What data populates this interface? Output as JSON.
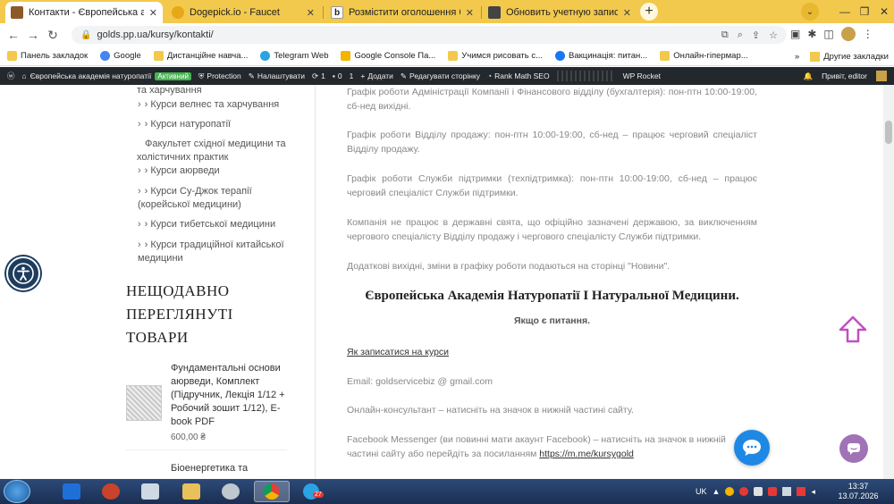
{
  "browser": {
    "tabs": [
      {
        "title": "Контакти - Європейська академ",
        "active": true,
        "favicon_color": "#8a5a2b"
      },
      {
        "title": "Dogepick.io - Faucet",
        "active": false,
        "favicon_color": "#e6a817"
      },
      {
        "title": "Розмістити оголошення безкош",
        "active": false,
        "favicon_color": "#222"
      },
      {
        "title": "Обновить учетную запись",
        "active": false,
        "favicon_color": "#444"
      }
    ],
    "new_tab": "+",
    "window_controls": [
      "—",
      "❐",
      "✕"
    ],
    "url": "golds.pp.ua/kursy/kontakti/"
  },
  "bookmarks": {
    "items": [
      {
        "label": "Панель закладок",
        "color": "#f2c94c"
      },
      {
        "label": "Google",
        "color": "#4285f4"
      },
      {
        "label": "Дистанційне навча...",
        "color": "#f2c94c"
      },
      {
        "label": "Telegram Web",
        "color": "#2aa3e1"
      },
      {
        "label": "Google Console Па...",
        "color": "#f4b400"
      },
      {
        "label": "Учимся рисовать с...",
        "color": "#f2c94c"
      },
      {
        "label": "Вакцинація: питан...",
        "color": "#1877f2"
      },
      {
        "label": "Онлайн-гіпермар...",
        "color": "#f2c94c"
      }
    ],
    "more": "»",
    "other": "Другие закладки"
  },
  "wpbar": {
    "site_name": "Європейська академія натуропатії",
    "status_badge": "Активний",
    "protection": "Protection",
    "customize": "Налаштувати",
    "updates": "1",
    "comments": "0",
    "comments_pending": "1",
    "add_new": "Додати",
    "edit_page": "Редагувати сторінку",
    "seo": "Rank Math SEO",
    "rocket": "WP Rocket",
    "greeting": "Привіт, editor"
  },
  "sidebar": {
    "links": [
      {
        "text": "та харчування",
        "chev": false
      },
      {
        "text": "› Курси велнес та харчування",
        "chev": true
      },
      {
        "text": "› Курси натуропатії",
        "chev": true
      },
      {
        "text": "Факультет східної медицини та холістичних практик",
        "chev": false
      },
      {
        "text": "› Курси аюрведи",
        "chev": true
      },
      {
        "text": "› Курси Су-Джок терапії (корейської медицини)",
        "chev": true
      },
      {
        "text": "› Курси тибетської медицини",
        "chev": true
      },
      {
        "text": "› Курси традиційної китайської медицини",
        "chev": true
      }
    ],
    "recent_heading": "НЕЩОДАВНО ПЕРЕГЛЯНУТІ ТОВАРИ",
    "product_title": "Фундаментальні основи аюрведи, Комплект (Підручник, Лекція 1/12 + Робочий зошит 1/12), E-book PDF",
    "product_price": "600,00 ₴",
    "product2_title": "Біоенергетика та"
  },
  "main": {
    "p1": "Графік роботи Адміністрації Компанії і Фінансового відділу (бухгалтерія): пон-птн 10:00-19:00, сб-нед вихідні.",
    "p2": "Графік роботи Відділу продажу: пон-птн 10:00-19:00, сб-нед – працює черговий спеціаліст Відділу продажу.",
    "p3": "Графік роботи Служби підтримки (техпідтримка): пон-птн 10:00-19:00, сб-нед – працює черговий спеціаліст Служби підтримки.",
    "p4": "Компанія не працює в державні свята, що офіційно зазначені державою, за виключенням чергового спеціалісту Відділу продажу і чергового спеціалісту Служби підтримки.",
    "p5": "Додаткові вихідні, зміни в графіку роботи подаються на сторінці \"Новини\".",
    "academy_title": "Європейська Академія Натуропатії І Натуральної Медицини.",
    "questions": "Якщо є питання.",
    "enroll_link": "Як записатися на курси",
    "email": "Email: goldservicebiz @ gmail.com",
    "consultant": "Онлайн-консультант – натисніть на значок в нижній частині сайту.",
    "messenger_prefix": "Facebook Messenger (ви повинні мати акаунт Facebook) – натисніть на значок в нижній частині сайту або перейдіть за посиланням ",
    "messenger_link": "https://m.me/kursygold"
  },
  "taskbar": {
    "lang": "UK",
    "time": "13:37",
    "date": "13.07.2026",
    "telegram_badge": "27"
  },
  "colors": {
    "tabstrip": "#f2c94c",
    "wpbar": "#23282d",
    "chat": "#1e88e5",
    "messenger": "#a072b6",
    "scroll_up": "#c050c0"
  }
}
